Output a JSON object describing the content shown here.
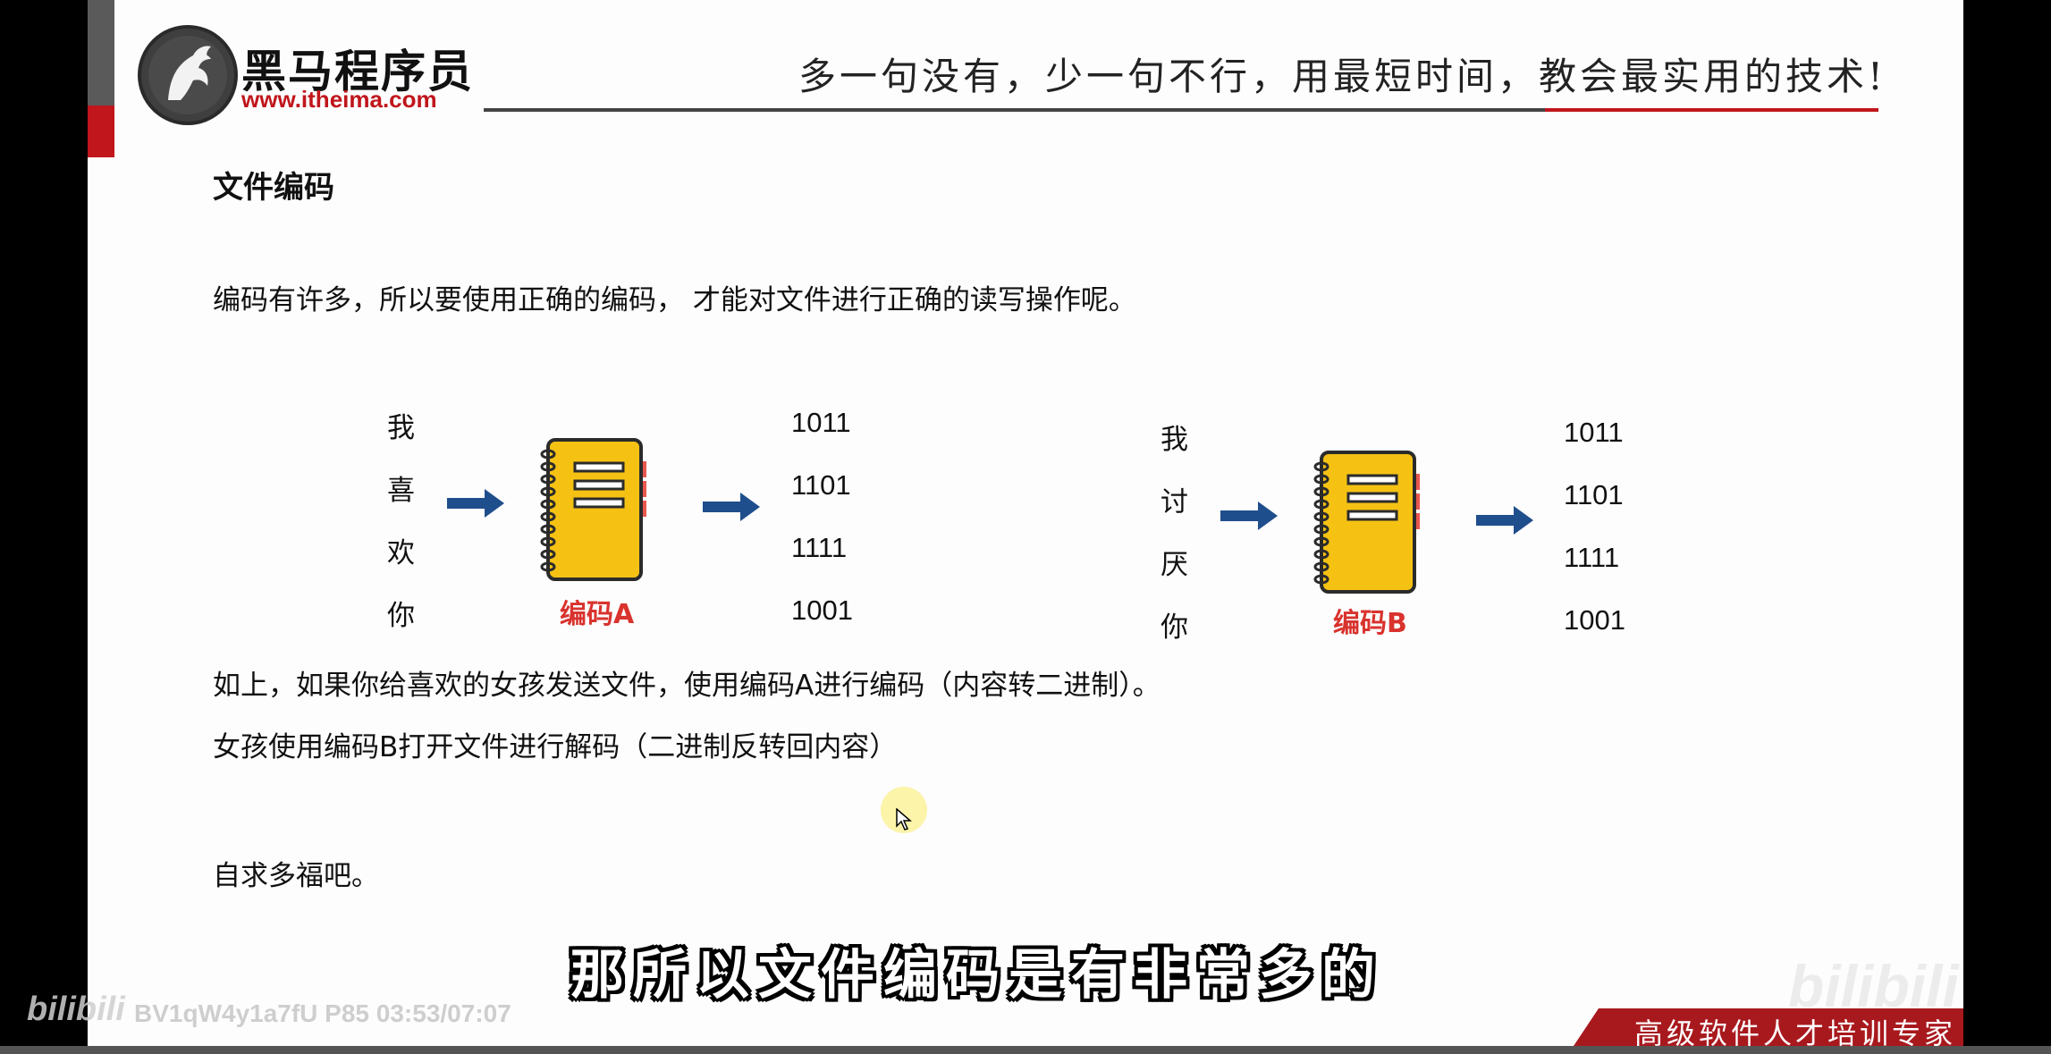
{
  "header": {
    "logo_cn": "黑马程序员",
    "logo_url": "www.itheima.com",
    "slogan": "多一句没有，少一句不行，用最短时间，教会最实用的技术!"
  },
  "slide": {
    "title": "文件编码",
    "intro": "编码有许多，所以要使用正确的编码， 才能对文件进行正确的读写操作呢。",
    "diagram_a": {
      "chars": [
        "我",
        "喜",
        "欢",
        "你"
      ],
      "label": "编码A",
      "bits": [
        "1011",
        "1101",
        "1111",
        "1001"
      ]
    },
    "diagram_b": {
      "chars": [
        "我",
        "讨",
        "厌",
        "你"
      ],
      "label": "编码B",
      "bits": [
        "1011",
        "1101",
        "1111",
        "1001"
      ]
    },
    "line1": "如上，如果你给喜欢的女孩发送文件，使用编码A进行编码（内容转二进制）。",
    "line2": "女孩使用编码B打开文件进行解码（二进制反转回内容）",
    "line3": "自求多福吧。"
  },
  "overlay": {
    "subtitle": "那所以文件编码是有非常多的",
    "footer": "高级软件人才培训专家",
    "watermark_left": "bilibili",
    "video_id": "BV1qW4y1a7fU P85 03:53/07:07",
    "watermark_right": "bilibili"
  },
  "colors": {
    "brand_red": "#c0161c",
    "book_yellow": "#f5c214",
    "arrow_blue": "#1f4e8c",
    "label_red": "#d9332e"
  }
}
